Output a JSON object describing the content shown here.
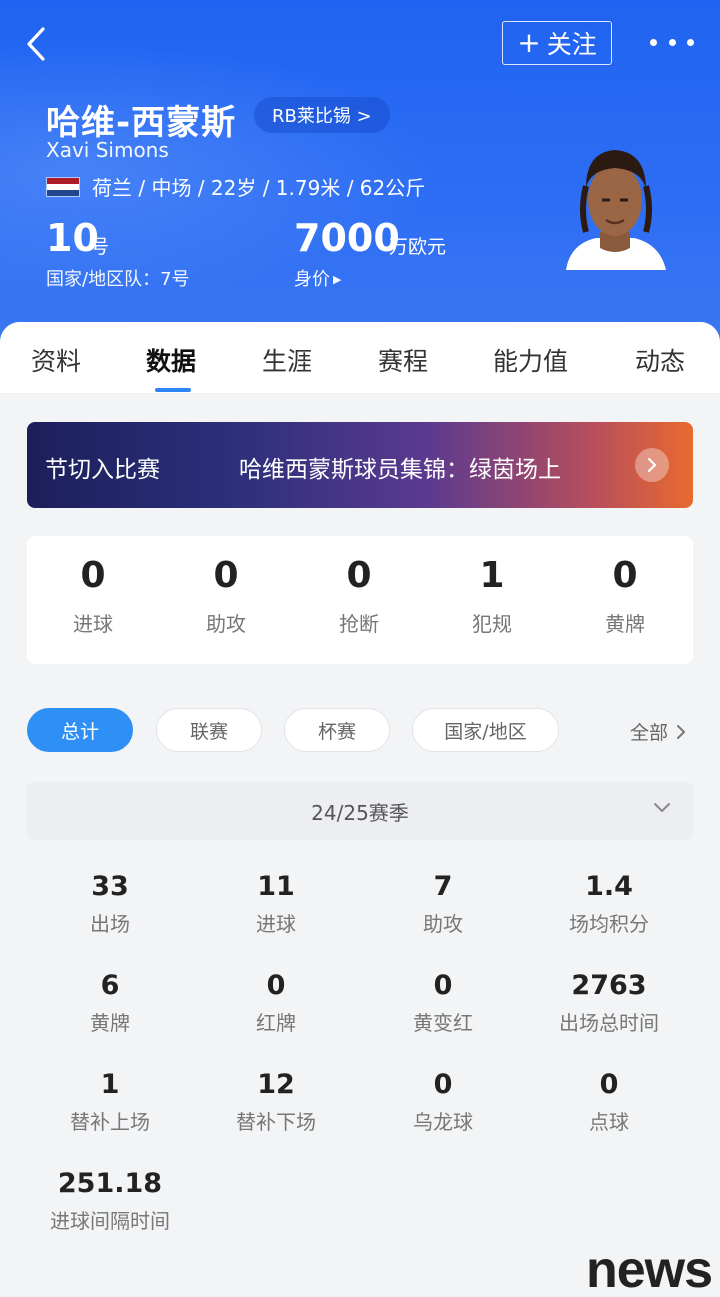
{
  "header": {
    "follow_label": "关注",
    "name_cn": "哈维-西蒙斯",
    "club": "RB莱比锡 >",
    "name_en": "Xavi Simons",
    "info": "荷兰 / 中场 / 22岁 / 1.79米 / 62公斤",
    "shirt_number": "10",
    "shirt_unit": "号",
    "national_team": "国家/地区队：7号",
    "market_value": "7000",
    "market_value_unit": "万欧元",
    "market_value_label": "身价"
  },
  "tabs": [
    "资料",
    "数据",
    "生涯",
    "赛程",
    "能力值",
    "动态"
  ],
  "active_tab": "数据",
  "banner": {
    "text_left": "节切入比赛",
    "text_right": "哈维西蒙斯球员集锦：绿茵场上"
  },
  "match_stats": [
    {
      "value": "0",
      "label": "进球"
    },
    {
      "value": "0",
      "label": "助攻"
    },
    {
      "value": "0",
      "label": "抢断"
    },
    {
      "value": "1",
      "label": "犯规"
    },
    {
      "value": "0",
      "label": "黄牌"
    }
  ],
  "filters": [
    "总计",
    "联赛",
    "杯赛",
    "国家/地区"
  ],
  "active_filter": "总计",
  "all_label": "全部",
  "season": "24/25赛季",
  "season_stats": [
    {
      "value": "33",
      "label": "出场"
    },
    {
      "value": "11",
      "label": "进球"
    },
    {
      "value": "7",
      "label": "助攻"
    },
    {
      "value": "1.4",
      "label": "场均积分"
    },
    {
      "value": "6",
      "label": "黄牌"
    },
    {
      "value": "0",
      "label": "红牌"
    },
    {
      "value": "0",
      "label": "黄变红"
    },
    {
      "value": "2763",
      "label": "出场总时间"
    },
    {
      "value": "1",
      "label": "替补上场"
    },
    {
      "value": "12",
      "label": "替补下场"
    },
    {
      "value": "0",
      "label": "乌龙球"
    },
    {
      "value": "0",
      "label": "点球"
    },
    {
      "value": "251.18",
      "label": "进球间隔时间"
    }
  ],
  "watermark": "news",
  "colors": {
    "header_blue": "#2e6ef4",
    "accent": "#2e90f6",
    "flag_red": "#ae1c28",
    "flag_white": "#ffffff",
    "flag_blue": "#21468b"
  }
}
